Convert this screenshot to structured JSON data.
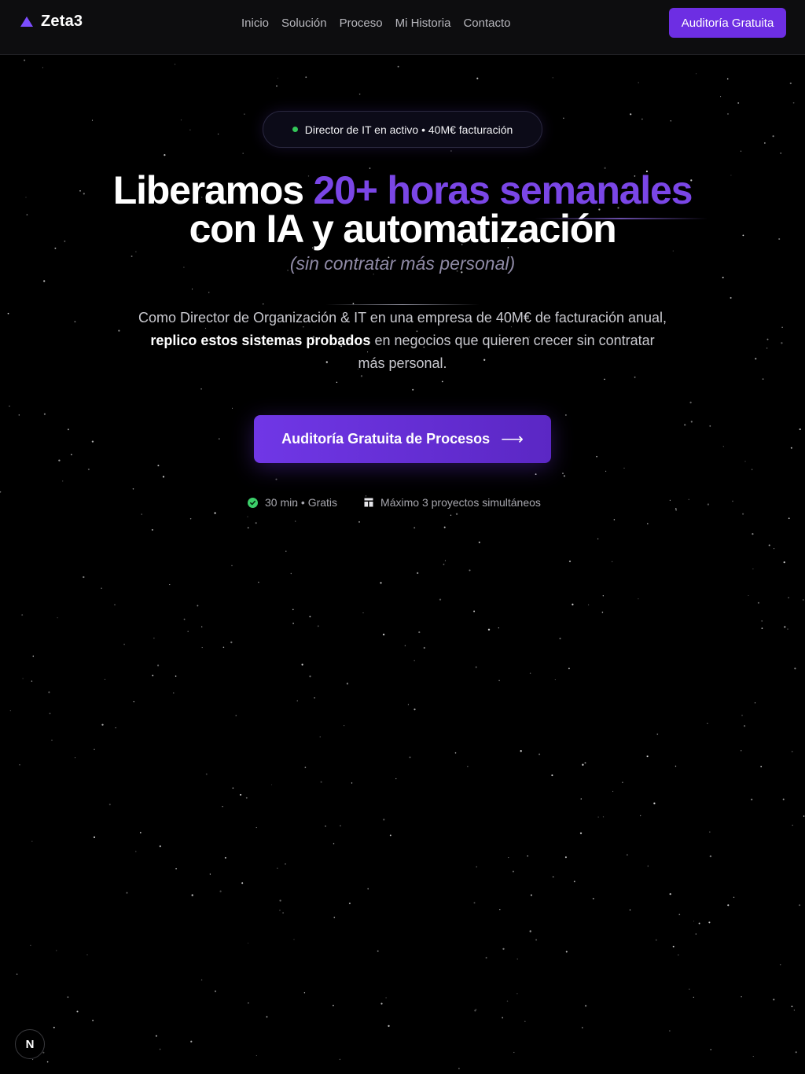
{
  "navbar": {
    "brand": "Zeta3",
    "links": [
      "Inicio",
      "Solución",
      "Proceso",
      "Mi Historia",
      "Contacto"
    ],
    "cta_label": "Auditoría Gratuita"
  },
  "hero": {
    "badge_text": "Director de IT en activo • 40M€ facturación",
    "headline_prefix": "Liberamos ",
    "headline_accent": "20+ horas semanales",
    "headline_line2": "con IA y automatización",
    "subheadline": "(sin contratar más personal)",
    "description_line1": "Como Director de Organización & IT en una empresa de 40M€ de facturación anual,",
    "description_bold": "replico estos sistemas probados",
    "description_rest": " en negocios que quieren crecer sin contratar más personal.",
    "cta_label": "Auditoría Gratuita de Procesos",
    "meta": [
      {
        "text": "30 min • Gratis",
        "icon": "check-circle-icon"
      },
      {
        "text": "Máximo 3 proyectos simultáneos",
        "icon": "layout-icon"
      }
    ]
  },
  "floating_badge": {
    "letter": "N"
  },
  "colors": {
    "background": "#000000",
    "accent": "#7a46e6",
    "cta": "#6d2ee3",
    "status_dot": "#34c759",
    "check": "#3ccf6a"
  }
}
